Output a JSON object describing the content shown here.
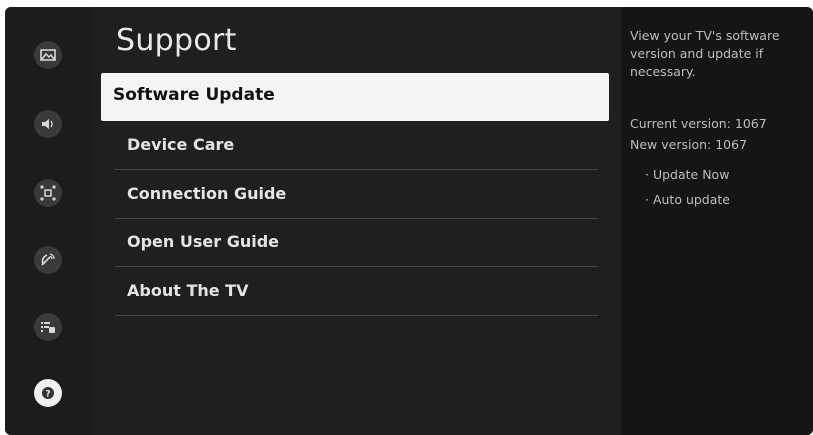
{
  "sidebar": {
    "icons": [
      "picture-icon",
      "sound-icon",
      "connection-icon",
      "broadcast-icon",
      "general-icon",
      "support-icon"
    ]
  },
  "main": {
    "title": "Support",
    "items": [
      {
        "label": "Software Update",
        "selected": true
      },
      {
        "label": "Device Care",
        "selected": false
      },
      {
        "label": "Connection Guide",
        "selected": false
      },
      {
        "label": "Open User Guide",
        "selected": false
      },
      {
        "label": "About The TV",
        "selected": false
      }
    ]
  },
  "info_panel": {
    "description": "View your TV's software version and update if necessary.",
    "current_version": "Current version: 1067",
    "new_version": "New version: 1067",
    "options": [
      "· Update Now",
      "· Auto update"
    ]
  }
}
